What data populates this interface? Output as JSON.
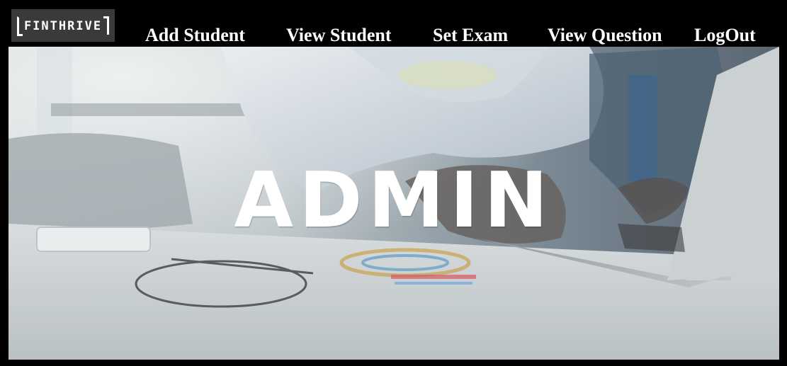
{
  "header": {
    "logo_text": "FINTHRIVE",
    "nav": [
      {
        "label": "Add Student"
      },
      {
        "label": "View Student"
      },
      {
        "label": "Set Exam"
      },
      {
        "label": "View Question"
      },
      {
        "label": "LogOut"
      }
    ]
  },
  "hero": {
    "title": "ADMIN",
    "background_description_icon": "office-desk-laptop-photo"
  },
  "colors": {
    "background": "#000000",
    "nav_text": "#ffffff",
    "hero_title": "#ffffff",
    "logo_bg": "#3a3a3a"
  }
}
